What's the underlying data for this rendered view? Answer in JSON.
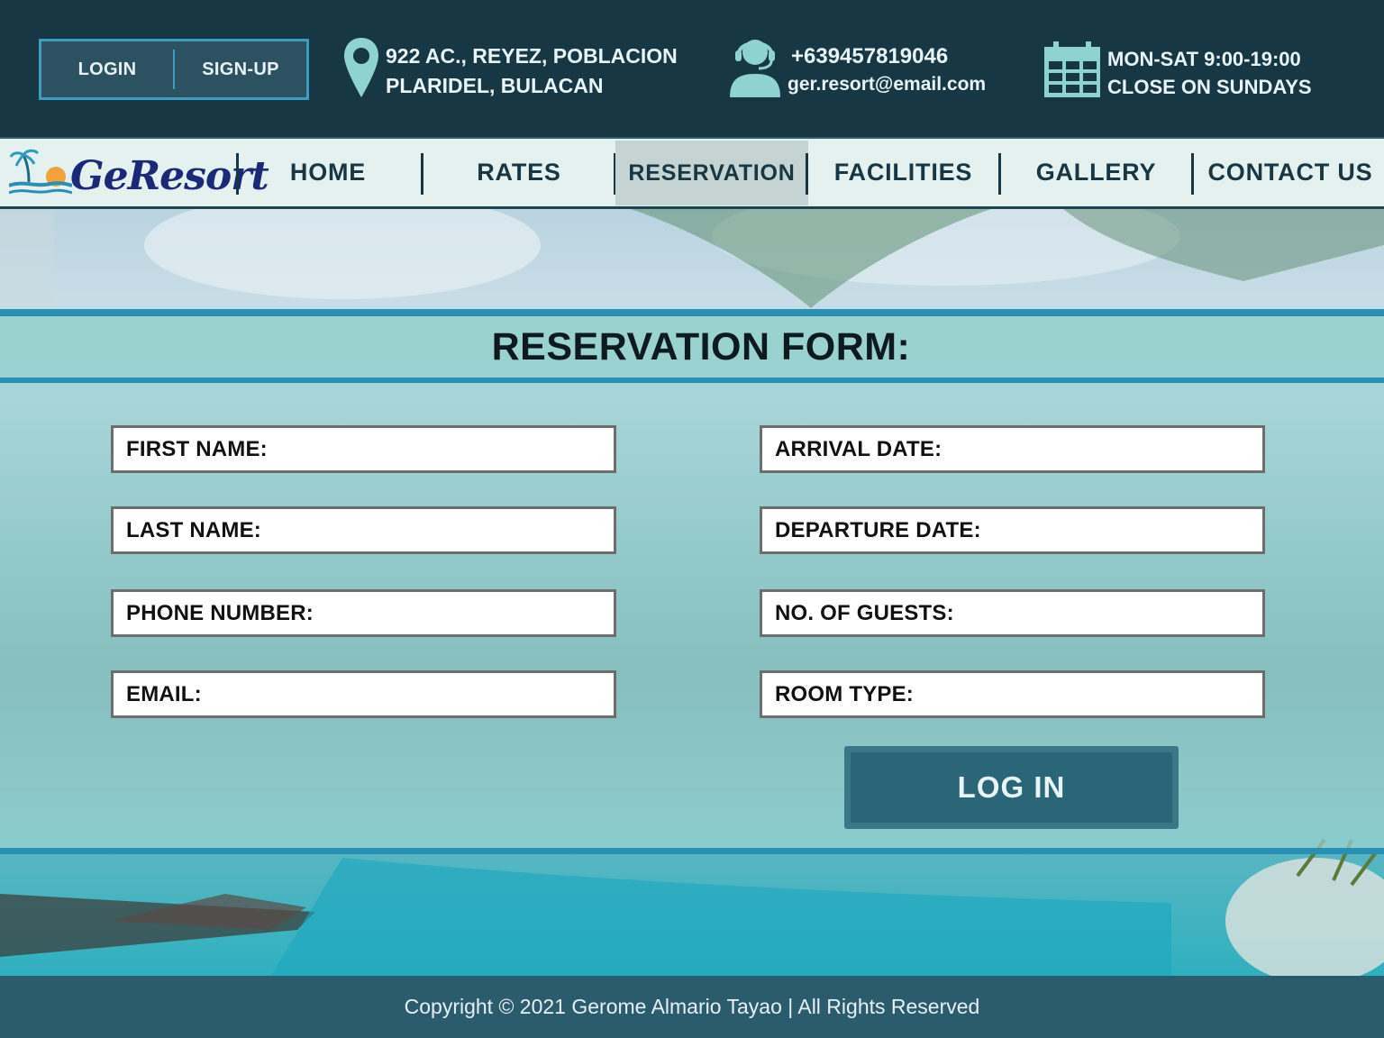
{
  "header": {
    "auth": {
      "login_label": "LOGIN",
      "signup_label": "SIGN-UP"
    },
    "address": {
      "line1": "922 AC., REYEZ, POBLACION",
      "line2": "PLARIDEL, BULACAN",
      "icon": "location-pin-icon"
    },
    "contact": {
      "phone": "+639457819046",
      "email": "ger.resort@email.com",
      "icon": "customer-support-icon"
    },
    "hours": {
      "line1": "MON-SAT 9:00-19:00",
      "line2": "CLOSE ON SUNDAYS",
      "icon": "calendar-icon"
    }
  },
  "nav": {
    "logo_text": "GeResort",
    "items": [
      {
        "label": "HOME"
      },
      {
        "label": "RATES"
      },
      {
        "label": "RESERVATION",
        "active": true
      },
      {
        "label": "FACILITIES"
      },
      {
        "label": "GALLERY"
      },
      {
        "label": "CONTACT US"
      }
    ]
  },
  "form": {
    "title": "RESERVATION FORM:",
    "left_fields": [
      {
        "label": "FIRST NAME:"
      },
      {
        "label": "LAST NAME:"
      },
      {
        "label": "PHONE NUMBER:"
      },
      {
        "label": "EMAIL:"
      }
    ],
    "right_fields": [
      {
        "label": "ARRIVAL DATE:"
      },
      {
        "label": "DEPARTURE DATE:"
      },
      {
        "label": "NO. OF GUESTS:"
      },
      {
        "label": "ROOM TYPE:"
      }
    ],
    "submit_label": "LOG IN"
  },
  "footer": {
    "text": "Copyright © 2021 Gerome Almario Tayao | All Rights Reserved"
  },
  "colors": {
    "header_bg": "#173744",
    "nav_bg": "#e4f1ef",
    "accent_blue": "#2a8fb5",
    "button_bg": "#2a6677",
    "footer_bg": "#2b5c6d"
  }
}
